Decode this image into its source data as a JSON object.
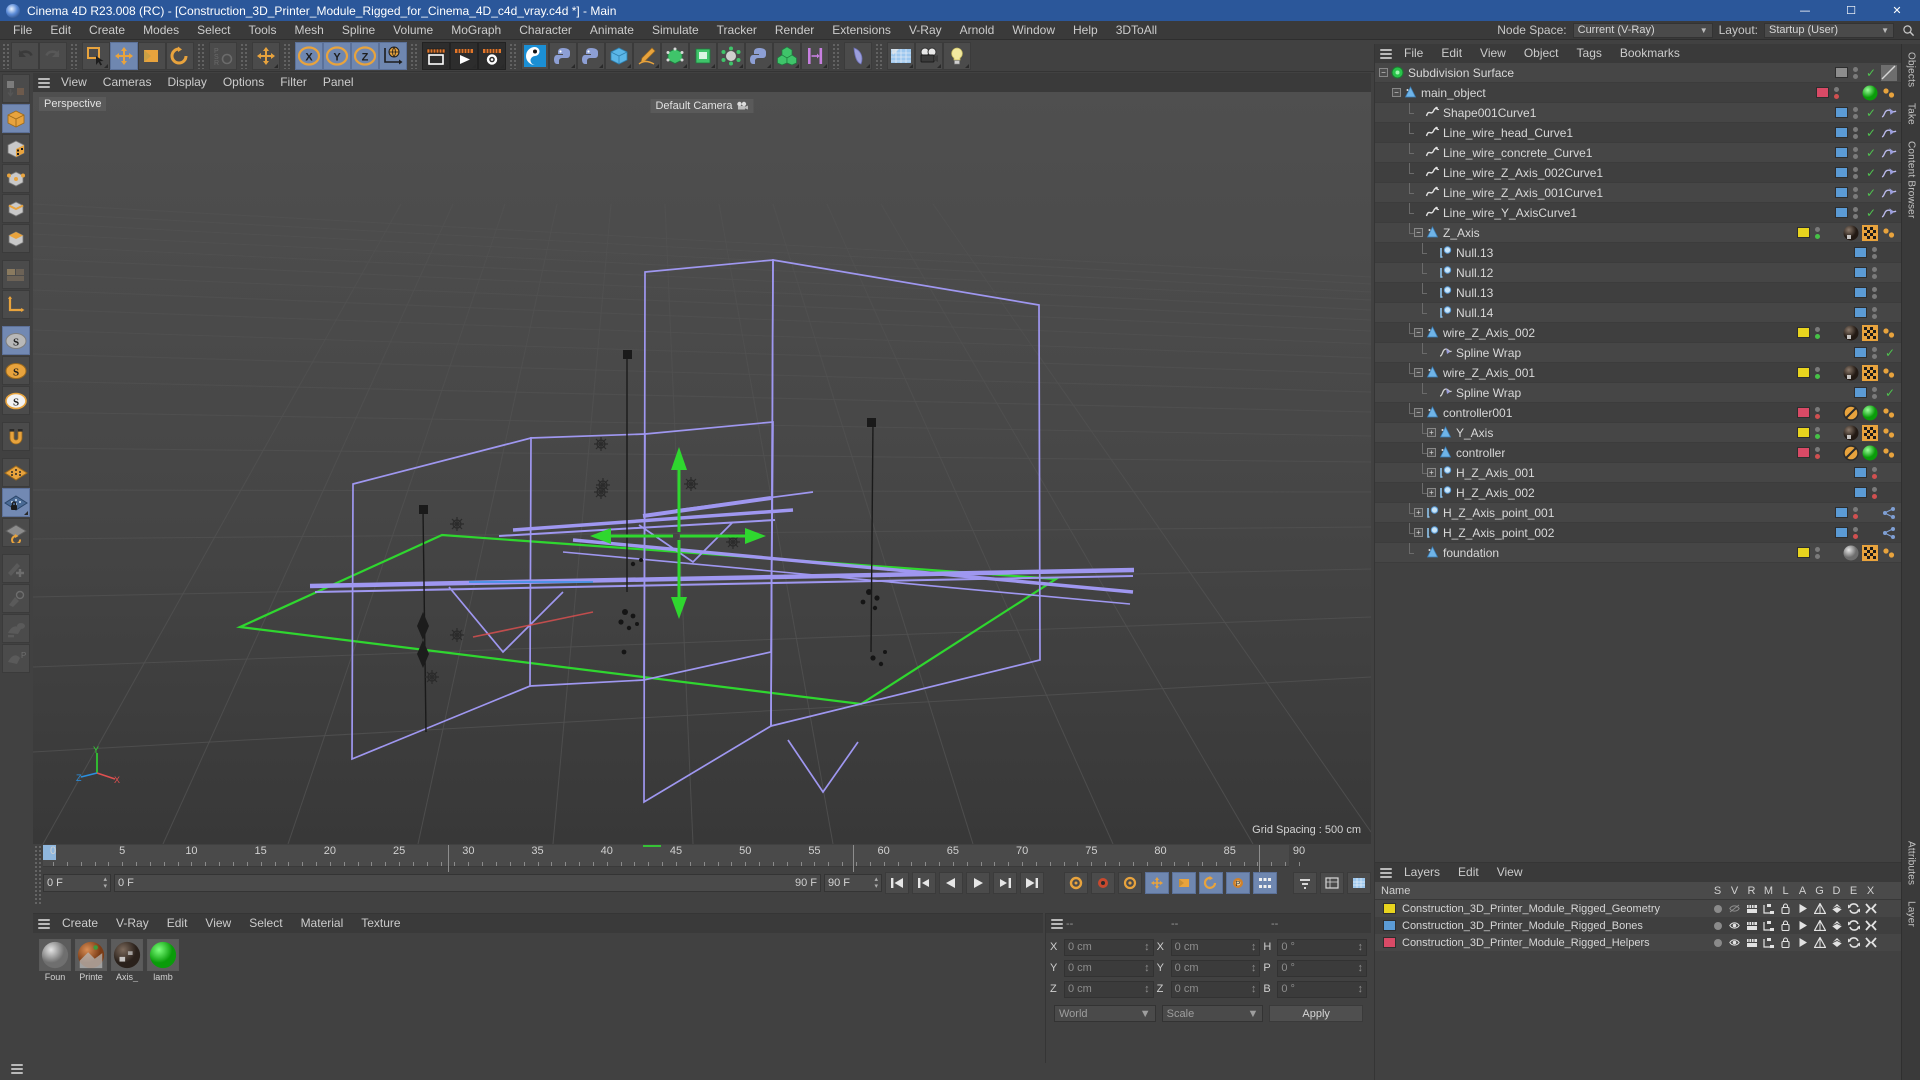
{
  "window": {
    "title": "Cinema 4D R23.008 (RC) - [Construction_3D_Printer_Module_Rigged_for_Cinema_4D_c4d_vray.c4d *] - Main",
    "minimize": "—",
    "maximize": "☐",
    "close": "✕",
    "accent": "#2b579a"
  },
  "menubar": {
    "items": [
      "File",
      "Edit",
      "Create",
      "Modes",
      "Select",
      "Tools",
      "Mesh",
      "Spline",
      "Volume",
      "MoGraph",
      "Character",
      "Animate",
      "Simulate",
      "Tracker",
      "Render",
      "Extensions",
      "V-Ray",
      "Arnold",
      "Window",
      "Help",
      "3DToAll"
    ],
    "node_space_label": "Node Space:",
    "node_space_value": "Current (V-Ray)",
    "layout_label": "Layout:",
    "layout_value": "Startup (User)",
    "search_icon": "search-icon"
  },
  "top_toolbar": {
    "groups": [
      {
        "buttons": [
          {
            "name": "undo-button",
            "icon": "undo",
            "state": "normal"
          },
          {
            "name": "redo-button",
            "icon": "redo",
            "state": "disabled"
          }
        ]
      },
      {
        "buttons": [
          {
            "name": "live-selection-button",
            "icon": "select",
            "state": "normal",
            "corner": true
          },
          {
            "name": "move-tool-button",
            "icon": "move",
            "state": "selected"
          },
          {
            "name": "scale-tool-button",
            "icon": "scale",
            "state": "normal"
          },
          {
            "name": "rotate-tool-button",
            "icon": "rotate",
            "state": "normal"
          }
        ]
      },
      {
        "buttons": [
          {
            "name": "psr-lock-button",
            "icon": "psr",
            "state": "dim"
          }
        ]
      },
      {
        "buttons": [
          {
            "name": "move-axis-button",
            "icon": "move",
            "state": "normal",
            "corner": true
          }
        ]
      },
      {
        "buttons": [
          {
            "name": "x-axis-button",
            "icon": "x-axis",
            "state": "selected"
          },
          {
            "name": "y-axis-button",
            "icon": "y-axis",
            "state": "selected"
          },
          {
            "name": "z-axis-button",
            "icon": "z-axis",
            "state": "selected"
          },
          {
            "name": "world-coordinate-button",
            "icon": "world",
            "state": "selected"
          }
        ]
      },
      {
        "buttons": [
          {
            "name": "render-view-button",
            "icon": "render-view",
            "state": "dark"
          },
          {
            "name": "render-to-picture-viewer-button",
            "icon": "render-pv",
            "state": "dark"
          },
          {
            "name": "render-settings-button",
            "icon": "render-settings",
            "state": "dark"
          }
        ]
      },
      {
        "buttons": [
          {
            "name": "content-browser-button",
            "icon": "c4d-logo",
            "state": "normal"
          },
          {
            "name": "python-generator-button",
            "icon": "python",
            "state": "normal",
            "corner": true
          },
          {
            "name": "python-tag-button",
            "icon": "python2",
            "state": "normal",
            "corner": true
          },
          {
            "name": "primitive-cube-button",
            "icon": "cube-blue",
            "state": "normal",
            "corner": true
          },
          {
            "name": "spline-pen-button",
            "icon": "pen",
            "state": "normal",
            "corner": true
          },
          {
            "name": "nurbs-button",
            "icon": "nurbs",
            "state": "normal",
            "corner": true
          },
          {
            "name": "array-button",
            "icon": "array-green",
            "state": "normal",
            "corner": true
          },
          {
            "name": "deformer-button",
            "icon": "deformer",
            "state": "normal",
            "corner": true
          },
          {
            "name": "scene-nodes-button",
            "icon": "python3",
            "state": "normal",
            "corner": true
          },
          {
            "name": "mograph-cloner-button",
            "icon": "cloner",
            "state": "normal",
            "corner": true
          },
          {
            "name": "field-button",
            "icon": "field",
            "state": "normal",
            "corner": true
          }
        ]
      },
      {
        "buttons": [
          {
            "name": "deformer-bend-button",
            "icon": "bend",
            "state": "normal",
            "corner": true
          }
        ]
      },
      {
        "buttons": [
          {
            "name": "environment-button",
            "icon": "floor",
            "state": "normal",
            "corner": true
          },
          {
            "name": "camera-button",
            "icon": "camera",
            "state": "normal",
            "corner": true
          },
          {
            "name": "light-button",
            "icon": "light",
            "state": "normal",
            "corner": true
          }
        ]
      }
    ]
  },
  "left_toolbar": {
    "buttons": [
      {
        "name": "make-editable-button",
        "icon": "editable",
        "state": "dim"
      },
      {
        "name": "model-mode-button",
        "icon": "model-cube",
        "state": "selected"
      },
      {
        "name": "texture-mode-button",
        "icon": "texture-cube",
        "state": "normal"
      },
      {
        "name": "points-mode-button",
        "icon": "points-cube",
        "state": "normal"
      },
      {
        "name": "edges-mode-button",
        "icon": "edges-cube",
        "state": "normal"
      },
      {
        "name": "polygons-mode-button",
        "icon": "polys-cube",
        "state": "normal"
      },
      {
        "name": "workplane-button",
        "icon": "workplane",
        "state": "dim"
      },
      {
        "name": "axis-mode-button",
        "icon": "axis-L",
        "state": "normal"
      },
      {
        "name": "enable-snap-button",
        "icon": "snap-s-gray",
        "state": "selected"
      },
      {
        "name": "snap-settings-button",
        "icon": "snap-s-orange",
        "state": "normal"
      },
      {
        "name": "quantize-button",
        "icon": "snap-s-white",
        "state": "normal"
      },
      {
        "name": "magnet-button",
        "icon": "magnet",
        "state": "normal"
      },
      {
        "name": "viewport-solo-button",
        "icon": "grid-orange",
        "state": "normal"
      },
      {
        "name": "lock-workplane-button",
        "icon": "grid-lock",
        "state": "selected",
        "corner": true
      },
      {
        "name": "workplane-rotate-button",
        "icon": "grid-rotate",
        "state": "normal"
      },
      {
        "name": "add-point-button",
        "icon": "add-point",
        "state": "dim"
      },
      {
        "name": "weight-tool-button",
        "icon": "weight",
        "state": "dim"
      },
      {
        "name": "bind-button",
        "icon": "bind",
        "state": "dim"
      },
      {
        "name": "pose-button",
        "icon": "pose-p",
        "state": "dim"
      }
    ]
  },
  "viewport": {
    "menu_items": [
      "View",
      "Cameras",
      "Display",
      "Options",
      "Filter",
      "Panel"
    ],
    "perspective_label": "Perspective",
    "camera_label": "Default Camera",
    "grid_spacing": "Grid Spacing : 500 cm",
    "axis_x": "X",
    "axis_y": "Y",
    "axis_z": "Z"
  },
  "timeline": {
    "ticks": [
      0,
      5,
      10,
      15,
      20,
      25,
      30,
      35,
      40,
      45,
      50,
      55,
      60,
      65,
      70,
      75,
      80,
      85,
      90
    ],
    "current_frame_field": "0 F",
    "start_frame": "0 F",
    "end_frame": "90 F",
    "range_end_field": "90 F",
    "preview_start": "0 F",
    "preview_end": "90 F",
    "playhead_frame": 0,
    "controls": [
      {
        "name": "go-to-start-button",
        "icon": "first-frame",
        "state": "normal"
      },
      {
        "name": "previous-frame-button",
        "icon": "prev-frame",
        "state": "normal"
      },
      {
        "name": "play-backward-button",
        "icon": "play-back",
        "state": "normal"
      },
      {
        "name": "play-forward-button",
        "icon": "play-fwd",
        "state": "normal"
      },
      {
        "name": "next-frame-button",
        "icon": "next-frame",
        "state": "normal"
      },
      {
        "name": "go-to-end-button",
        "icon": "last-frame",
        "state": "normal"
      },
      {
        "name": "record-settings-button",
        "icon": "rec-settings",
        "state": "normal"
      },
      {
        "name": "autokey-button",
        "icon": "record-dot",
        "state": "normal"
      },
      {
        "name": "keyframe-settings-button",
        "icon": "key-gear",
        "state": "normal"
      },
      {
        "name": "record-position-button",
        "icon": "key-pos",
        "state": "on"
      },
      {
        "name": "record-scale-button",
        "icon": "key-scale",
        "state": "on"
      },
      {
        "name": "record-rotation-button",
        "icon": "key-rot",
        "state": "on"
      },
      {
        "name": "record-param-button",
        "icon": "key-param",
        "state": "on"
      },
      {
        "name": "record-pla-button",
        "icon": "key-pla",
        "state": "on"
      },
      {
        "name": "keyframe-selection-button",
        "icon": "key-sel",
        "state": "normal"
      },
      {
        "name": "autokeying-button",
        "icon": "autokey",
        "state": "normal"
      },
      {
        "name": "timeline-settings-button",
        "icon": "tl-settings",
        "state": "normal"
      }
    ]
  },
  "material_manager": {
    "menu_items": [
      "Create",
      "V-Ray",
      "Edit",
      "View",
      "Select",
      "Material",
      "Texture"
    ],
    "materials": [
      {
        "name": "Foun",
        "color": "#9a9a9a",
        "kind": "gray"
      },
      {
        "name": "Printe",
        "color": "#b05a2a",
        "kind": "texture"
      },
      {
        "name": "Axis_",
        "color": "#4a3a30",
        "kind": "dark"
      },
      {
        "name": "lamb",
        "color": "#17d117",
        "kind": "green"
      }
    ]
  },
  "coordinates": {
    "header_dashes": [
      "--",
      "--",
      "--"
    ],
    "rows": [
      {
        "pos_label": "X",
        "pos_value": "0 cm",
        "size_label": "X",
        "size_value": "0 cm",
        "rot_label": "H",
        "rot_value": "0 °"
      },
      {
        "pos_label": "Y",
        "pos_value": "0 cm",
        "size_label": "Y",
        "size_value": "0 cm",
        "rot_label": "P",
        "rot_value": "0 °"
      },
      {
        "pos_label": "Z",
        "pos_value": "0 cm",
        "size_label": "Z",
        "size_value": "0 cm",
        "rot_label": "B",
        "rot_value": "0 °"
      }
    ],
    "system": "World",
    "mode": "Scale",
    "apply_label": "Apply"
  },
  "object_manager": {
    "menu_items": [
      "File",
      "Edit",
      "View",
      "Object",
      "Tags",
      "Bookmarks"
    ],
    "rows": [
      {
        "name": "Subdivision Surface",
        "indent": 0,
        "icon": "subdivision-surface-icon",
        "expander": "minus",
        "swatch": "#8d8d8d",
        "dots": "gray-gray",
        "check": true,
        "tags": [
          "hatch-tag"
        ]
      },
      {
        "name": "main_object",
        "indent": 1,
        "icon": "null-axis-icon",
        "expander": "minus",
        "swatch": "#d94a66",
        "dots": "gray-red",
        "check": false,
        "tags": [
          "green-sphere-tag",
          "dots-tag"
        ]
      },
      {
        "name": "Shape001Curve1",
        "indent": 2,
        "icon": "spline-icon",
        "expander": "none",
        "swatch": "#5b9bd5",
        "dots": "gray-gray",
        "check": true,
        "tags": [
          "spline-wrap-tag"
        ]
      },
      {
        "name": "Line_wire_head_Curve1",
        "indent": 2,
        "icon": "spline-icon",
        "expander": "none",
        "swatch": "#5b9bd5",
        "dots": "gray-gray",
        "check": true,
        "tags": [
          "spline-wrap-tag"
        ]
      },
      {
        "name": "Line_wire_concrete_Curve1",
        "indent": 2,
        "icon": "spline-icon",
        "expander": "none",
        "swatch": "#5b9bd5",
        "dots": "gray-gray",
        "check": true,
        "tags": [
          "spline-wrap-tag"
        ]
      },
      {
        "name": "Line_wire_Z_Axis_002Curve1",
        "indent": 2,
        "icon": "spline-icon",
        "expander": "none",
        "swatch": "#5b9bd5",
        "dots": "gray-gray",
        "check": true,
        "tags": [
          "spline-wrap-tag"
        ]
      },
      {
        "name": "Line_wire_Z_Axis_001Curve1",
        "indent": 2,
        "icon": "spline-icon",
        "expander": "none",
        "swatch": "#5b9bd5",
        "dots": "gray-gray",
        "check": true,
        "tags": [
          "spline-wrap-tag"
        ]
      },
      {
        "name": "Line_wire_Y_AxisCurve1",
        "indent": 2,
        "icon": "spline-icon",
        "expander": "none",
        "swatch": "#5b9bd5",
        "dots": "gray-gray",
        "check": true,
        "tags": [
          "spline-wrap-tag"
        ]
      },
      {
        "name": "Z_Axis",
        "indent": 2,
        "icon": "null-axis-icon",
        "expander": "minus",
        "swatch": "#e8d41e",
        "dots": "gray-green",
        "check": false,
        "tags": [
          "material-tag",
          "checker-tag",
          "dot-tag"
        ]
      },
      {
        "name": "Null.13",
        "indent": 3,
        "icon": "null-icon",
        "expander": "none",
        "swatch": "#5b9bd5",
        "dots": "gray-gray",
        "check": false,
        "tags": []
      },
      {
        "name": "Null.12",
        "indent": 3,
        "icon": "null-icon",
        "expander": "none",
        "swatch": "#5b9bd5",
        "dots": "gray-gray",
        "check": false,
        "tags": []
      },
      {
        "name": "Null.13",
        "indent": 3,
        "icon": "null-icon",
        "expander": "none",
        "swatch": "#5b9bd5",
        "dots": "gray-gray",
        "check": false,
        "tags": []
      },
      {
        "name": "Null.14",
        "indent": 3,
        "icon": "null-icon",
        "expander": "none",
        "swatch": "#5b9bd5",
        "dots": "gray-gray",
        "check": false,
        "tags": []
      },
      {
        "name": "wire_Z_Axis_002",
        "indent": 2,
        "icon": "null-axis-icon",
        "expander": "minus",
        "swatch": "#e8d41e",
        "dots": "gray-green",
        "check": false,
        "tags": [
          "material-tag",
          "checker-tag",
          "dot-tag"
        ]
      },
      {
        "name": "Spline Wrap",
        "indent": 3,
        "icon": "spline-wrap-icon",
        "expander": "none",
        "swatch": "#5b9bd5",
        "dots": "gray-gray",
        "check": true,
        "tags": []
      },
      {
        "name": "wire_Z_Axis_001",
        "indent": 2,
        "icon": "null-axis-icon",
        "expander": "minus",
        "swatch": "#e8d41e",
        "dots": "gray-green",
        "check": false,
        "tags": [
          "material-tag",
          "checker-tag",
          "dot-tag"
        ]
      },
      {
        "name": "Spline Wrap",
        "indent": 3,
        "icon": "spline-wrap-icon",
        "expander": "none",
        "swatch": "#5b9bd5",
        "dots": "gray-gray",
        "check": true,
        "tags": []
      },
      {
        "name": "controller001",
        "indent": 2,
        "icon": "null-axis-icon",
        "expander": "minus",
        "swatch": "#d94a66",
        "dots": "gray-red",
        "check": false,
        "tags": [
          "no-tag",
          "green-sphere-tag",
          "dot-tag"
        ]
      },
      {
        "name": "Y_Axis",
        "indent": 3,
        "icon": "null-axis-icon",
        "expander": "plus",
        "swatch": "#e8d41e",
        "dots": "gray-green",
        "check": false,
        "tags": [
          "material-tag",
          "checker-tag",
          "dot-tag"
        ]
      },
      {
        "name": "controller",
        "indent": 3,
        "icon": "null-axis-icon",
        "expander": "plus",
        "swatch": "#d94a66",
        "dots": "gray-red",
        "check": false,
        "tags": [
          "no-tag",
          "green-sphere-tag",
          "dot-tag"
        ]
      },
      {
        "name": "H_Z_Axis_001",
        "indent": 3,
        "icon": "null-icon",
        "expander": "plus",
        "swatch": "#5b9bd5",
        "dots": "gray-red",
        "check": false,
        "tags": []
      },
      {
        "name": "H_Z_Axis_002",
        "indent": 3,
        "icon": "null-icon",
        "expander": "plus",
        "swatch": "#5b9bd5",
        "dots": "gray-red",
        "check": false,
        "tags": []
      },
      {
        "name": "H_Z_Axis_point_001",
        "indent": 2,
        "icon": "null-icon",
        "expander": "plus",
        "swatch": "#5b9bd5",
        "dots": "gray-red",
        "check": false,
        "tags": [
          "constraint-tag"
        ]
      },
      {
        "name": "H_Z_Axis_point_002",
        "indent": 2,
        "icon": "null-icon",
        "expander": "plus",
        "swatch": "#5b9bd5",
        "dots": "gray-red",
        "check": false,
        "tags": [
          "constraint-tag"
        ]
      },
      {
        "name": "foundation",
        "indent": 2,
        "icon": "null-axis-icon",
        "expander": "none",
        "swatch": "#e8d41e",
        "dots": "gray-gray",
        "check": false,
        "tags": [
          "gray-sphere-tag",
          "checker-tag",
          "dot-tag"
        ]
      }
    ]
  },
  "layers_manager": {
    "menu_items": [
      "Layers",
      "Edit",
      "View"
    ],
    "columns": [
      "Name",
      "S",
      "V",
      "R",
      "M",
      "L",
      "A",
      "G",
      "D",
      "E",
      "X"
    ],
    "rows": [
      {
        "name": "Construction_3D_Printer_Module_Rigged_Geometry",
        "color": "#e8d41e",
        "visible": false
      },
      {
        "name": "Construction_3D_Printer_Module_Rigged_Bones",
        "color": "#5b9bd5",
        "visible": true
      },
      {
        "name": "Construction_3D_Printer_Module_Rigged_Helpers",
        "color": "#d94a66",
        "visible": true
      }
    ]
  },
  "edge_tabs": [
    "Objects",
    "Take",
    "Content Browser",
    "Attributes",
    "Layer"
  ]
}
